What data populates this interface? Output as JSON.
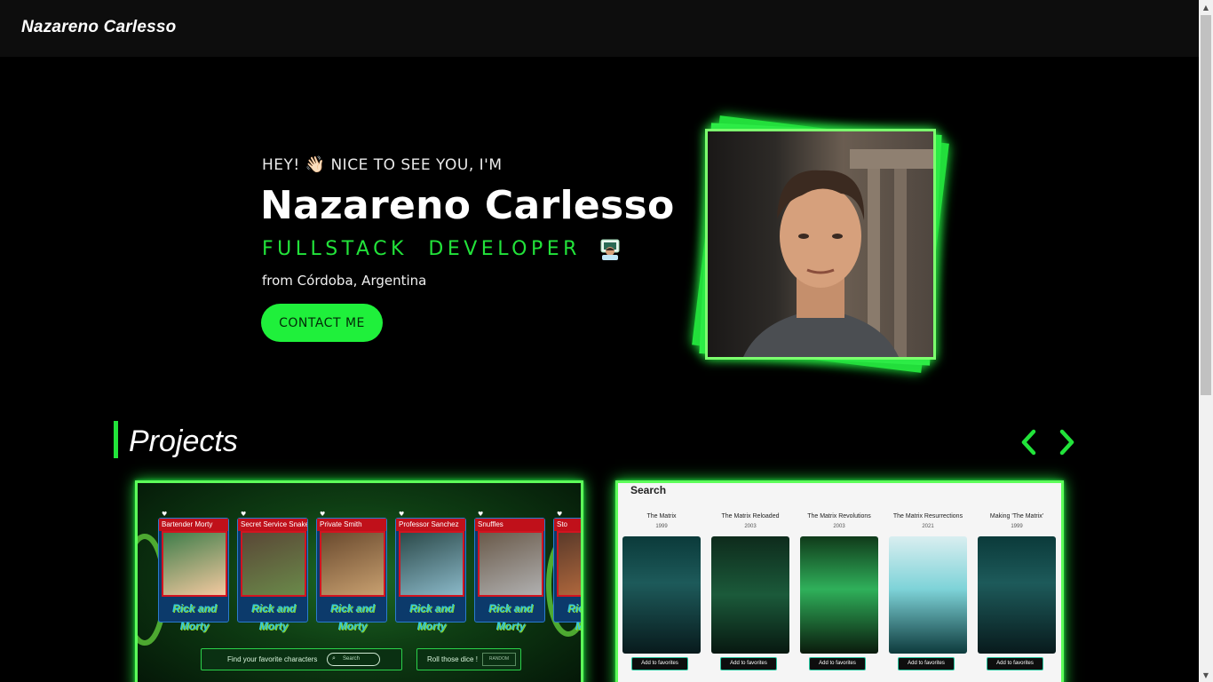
{
  "navbar": {
    "brand": "Nazareno Carlesso"
  },
  "hero": {
    "greeting": "HEY!",
    "wave_emoji": "👋🏻",
    "greeting_rest": "NICE TO SEE YOU, I'M",
    "name": "Nazareno Carlesso",
    "role": "FULLSTACK DEVELOPER",
    "location": "from Córdoba, Argentina",
    "contact_label": "CONTACT ME",
    "profile_photo": "profile-photo"
  },
  "projects": {
    "title": "Projects",
    "prev_icon": "chevron-left-icon",
    "next_icon": "chevron-right-icon",
    "accent": "#22e33a"
  },
  "rick_and_morty": {
    "cards": [
      {
        "name": "Bartender Morty"
      },
      {
        "name": "Secret Service Snake"
      },
      {
        "name": "Private Smith"
      },
      {
        "name": "Professor Sanchez"
      },
      {
        "name": "Snuffles"
      },
      {
        "name": "Sto"
      }
    ],
    "search_label": "Find your favorite characters",
    "search_placeholder": "Search",
    "random_label": "Roll those dice !",
    "random_button": "RANDOM"
  },
  "matrix": {
    "search_label": "Search",
    "movies": [
      {
        "title": "The Matrix",
        "year": "1999",
        "fav": "Add to favorites"
      },
      {
        "title": "The Matrix Reloaded",
        "year": "2003",
        "fav": "Add to favorites"
      },
      {
        "title": "The Matrix Revolutions",
        "year": "2003",
        "fav": "Add to favorites"
      },
      {
        "title": "The Matrix Resurrections",
        "year": "2021",
        "fav": "Add to favorites"
      },
      {
        "title": "Making 'The Matrix'",
        "year": "1999",
        "fav": "Add to favorites"
      }
    ]
  }
}
